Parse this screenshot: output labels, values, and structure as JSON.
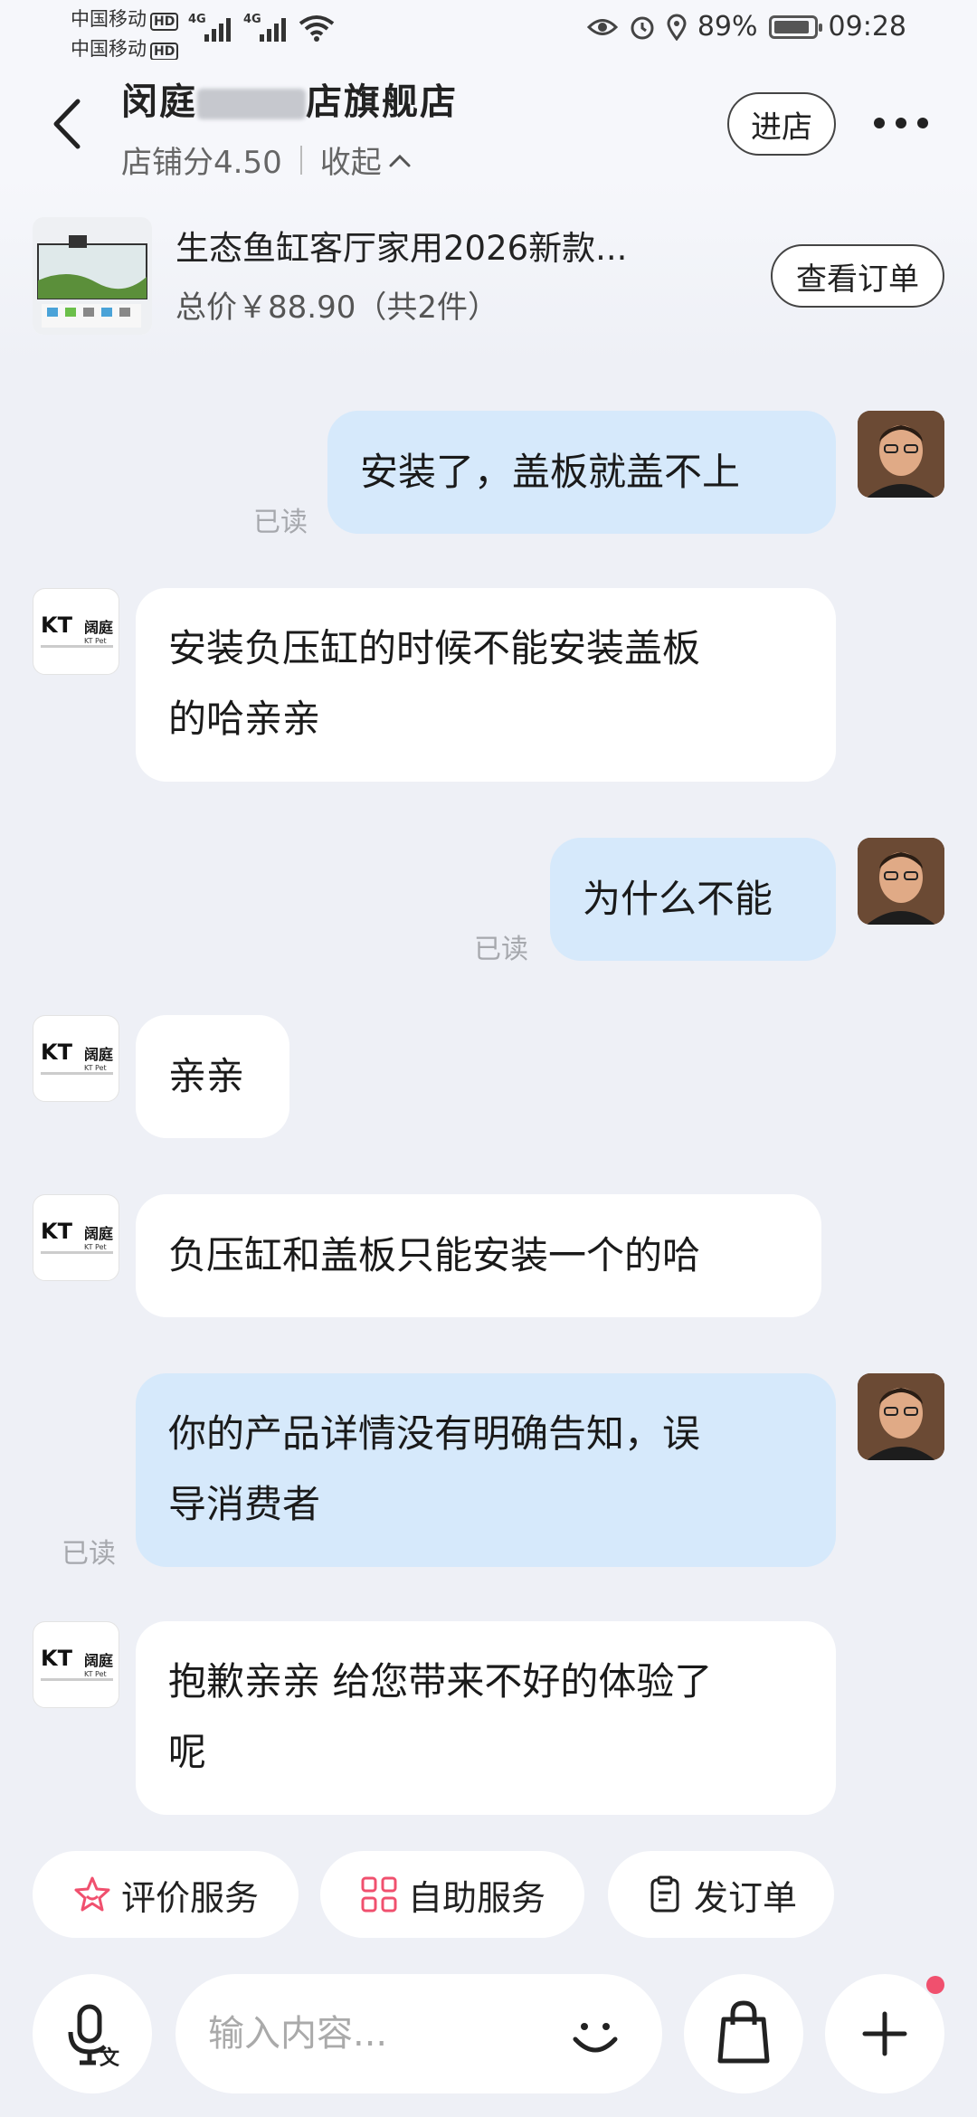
{
  "status_bar": {
    "carrier1": "中国移动",
    "carrier2": "中国移动",
    "hd": "HD",
    "net1": "4G",
    "net2": "4G",
    "battery": "89%",
    "time": "09:28"
  },
  "header": {
    "shop_name_visible_start": "闵庭",
    "shop_name_visible_end": "店旗舰店",
    "shop_score": "店铺分4.50",
    "collapse_label": "收起",
    "enter_label": "进店"
  },
  "order": {
    "title": "生态鱼缸客厅家用2026新款...",
    "price": "总价￥88.90（共2件）",
    "view_label": "查看订单"
  },
  "messages": [
    {
      "from": "me",
      "text": "安装了，盖板就盖不上",
      "read": "已读"
    },
    {
      "from": "shop",
      "line1": "安装负压缸的时候不能安装盖板",
      "line2": "的哈亲亲"
    },
    {
      "from": "me",
      "text": "为什么不能",
      "read": "已读"
    },
    {
      "from": "shop",
      "text": "亲亲"
    },
    {
      "from": "shop",
      "text": "负压缸和盖板只能安装一个的哈"
    },
    {
      "from": "me",
      "line1": "你的产品详情没有明确告知，误",
      "line2": "导消费者",
      "read": "已读"
    },
    {
      "from": "shop",
      "line1": "抱歉亲亲 给您带来不好的体验了",
      "line2": "呢"
    }
  ],
  "shop_logo": {
    "brand": "KT",
    "cn": "阔庭",
    "sub": "KT Pet"
  },
  "quick_actions": {
    "rate": "评价服务",
    "self_service": "自助服务",
    "send_order": "发订单"
  },
  "input": {
    "placeholder": "输入内容..."
  },
  "colors": {
    "my_bubble": "#d6e9fb",
    "shop_bubble": "#ffffff",
    "background": "#eef0f6",
    "badge": "#f0506e"
  }
}
